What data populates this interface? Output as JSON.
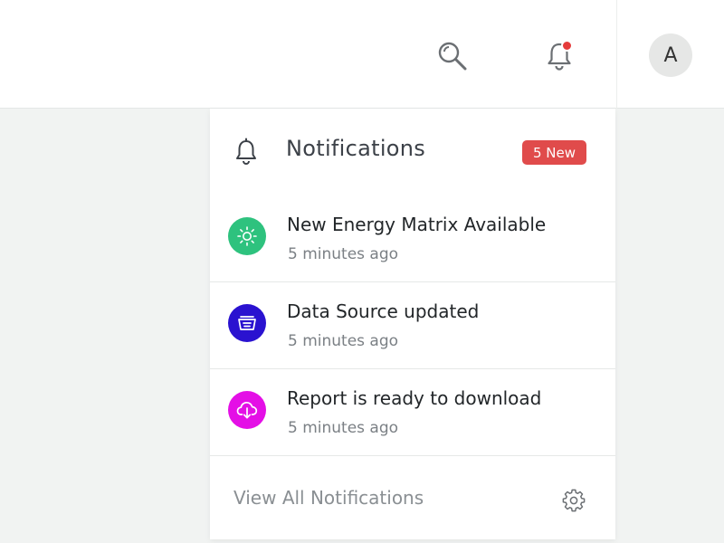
{
  "topbar": {
    "avatar_letter": "A",
    "search_icon": "search-icon",
    "bell_icon": "bell-icon",
    "unread_indicator_color": "#e53b3b"
  },
  "panel": {
    "title": "Notifications",
    "badge": "5 New",
    "badge_color": "#e04b4b",
    "items": [
      {
        "title": "New Energy Matrix Available",
        "time": "5 minutes ago",
        "icon": "sun-icon",
        "color": "#2ec27e"
      },
      {
        "title": "Data Source updated",
        "time": "5 minutes ago",
        "icon": "inbox-tray-icon",
        "color": "#2a12d0"
      },
      {
        "title": "Report is ready to download",
        "time": "5 minutes ago",
        "icon": "cloud-download-icon",
        "color": "#e40fe6"
      }
    ],
    "footer": {
      "view_all_label": "View All Notifications",
      "settings_icon": "gear-icon"
    }
  }
}
